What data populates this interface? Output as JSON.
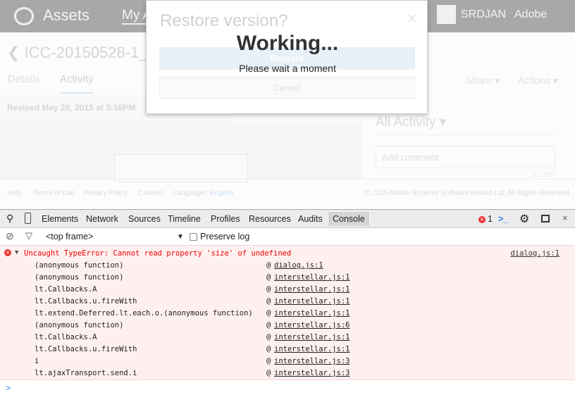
{
  "app": {
    "brand": "Assets",
    "nav_partial": "My A",
    "user": "SRDJAN",
    "adobe": "Adobe"
  },
  "asset": {
    "title": "ICC-20150528-1_ed",
    "tabs": [
      "Details",
      "Activity"
    ],
    "share": "Share ▾",
    "actions": "Actions ▾",
    "revised": "Revised May 28, 2015 at 3:16PM"
  },
  "activity": {
    "filter": "All Activity ▾",
    "comment_placeholder": "Add comment",
    "count": "0/1000"
  },
  "footer": {
    "links": [
      "Help",
      "Terms of Use",
      "Privacy Policy",
      "Cookies"
    ],
    "language_label": "Language:",
    "language": "English",
    "copyright": "© 2015 Adobe Systems Software Ireland Ltd. All Rights Reserved."
  },
  "dialog": {
    "title": "Restore version?",
    "close": "×",
    "restore": "Restore",
    "cancel": "Cancel",
    "working": "Working...",
    "wait": "Please wait a moment"
  },
  "devtools": {
    "tabs": [
      "Elements",
      "Network",
      "Sources",
      "Timeline",
      "Profiles",
      "Resources",
      "Audits",
      "Console"
    ],
    "active_tab": "Console",
    "error_count": "1",
    "frame": "<top frame>",
    "preserve_log": "Preserve log",
    "preserve_checked": false,
    "error": {
      "message": "Uncaught TypeError: Cannot read property 'size' of undefined",
      "source": "dialog.js:1",
      "stack": [
        {
          "fn": "(anonymous function)",
          "loc": "dialog.js:1"
        },
        {
          "fn": "(anonymous function)",
          "loc": "interstellar.js:1"
        },
        {
          "fn": "lt.Callbacks.A",
          "loc": "interstellar.js:1"
        },
        {
          "fn": "lt.Callbacks.u.fireWith",
          "loc": "interstellar.js:1"
        },
        {
          "fn": "lt.extend.Deferred.lt.each.o.(anonymous function)",
          "loc": "interstellar.js:1"
        },
        {
          "fn": "(anonymous function)",
          "loc": "interstellar.js:6"
        },
        {
          "fn": "lt.Callbacks.A",
          "loc": "interstellar.js:1"
        },
        {
          "fn": "lt.Callbacks.u.fireWith",
          "loc": "interstellar.js:1"
        },
        {
          "fn": "i",
          "loc": "interstellar.js:3"
        },
        {
          "fn": "lt.ajaxTransport.send.i",
          "loc": "interstellar.js:3"
        }
      ]
    }
  }
}
